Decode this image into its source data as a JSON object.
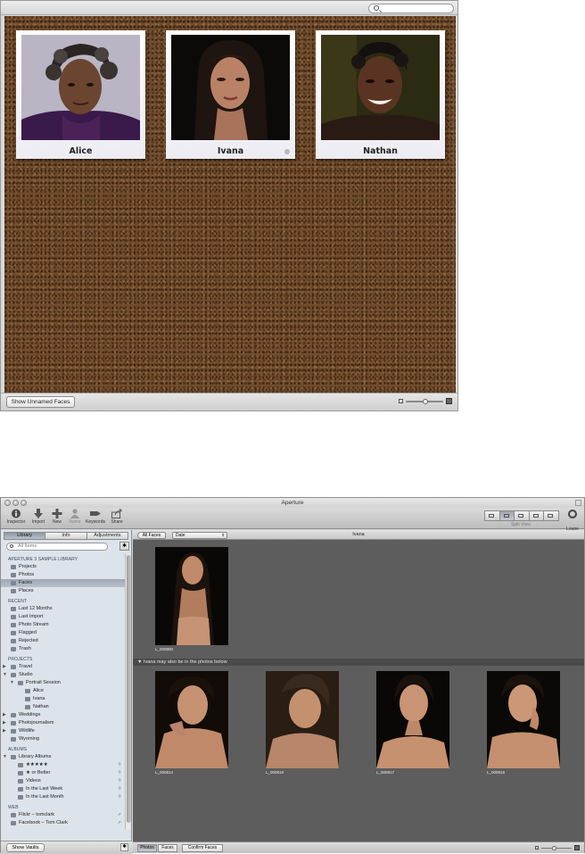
{
  "corkboard": {
    "faces": [
      {
        "name": "Alice"
      },
      {
        "name": "Ivana"
      },
      {
        "name": "Nathan"
      }
    ],
    "show_unnamed_label": "Show Unnamed Faces"
  },
  "aperture": {
    "window_title": "Aperture",
    "toolbar": {
      "left": [
        "Inspector",
        "Import",
        "New",
        "Name",
        "Keywords",
        "Share"
      ],
      "split_view_label": "Split View",
      "loupe_label": "Loupe"
    },
    "sidebar": {
      "tabs": [
        "Library",
        "Info",
        "Adjustments"
      ],
      "active_tab": "Library",
      "search_placeholder": "All Items",
      "sections": [
        {
          "title": "APERTURE 3 SAMPLE LIBRARY",
          "items": [
            {
              "label": "Projects",
              "icon": "projects-icon"
            },
            {
              "label": "Photos",
              "icon": "photos-icon"
            },
            {
              "label": "Faces",
              "icon": "faces-icon",
              "selected": true
            },
            {
              "label": "Places",
              "icon": "places-icon"
            }
          ]
        },
        {
          "title": "RECENT",
          "items": [
            {
              "label": "Last 12 Months",
              "icon": "calendar-icon"
            },
            {
              "label": "Last Import",
              "icon": "import-icon"
            },
            {
              "label": "Photo Stream",
              "icon": "photo-stream-icon"
            },
            {
              "label": "Flagged",
              "icon": "flag-icon"
            },
            {
              "label": "Rejected",
              "icon": "reject-icon"
            },
            {
              "label": "Trash",
              "icon": "trash-icon"
            }
          ]
        },
        {
          "title": "PROJECTS",
          "items": [
            {
              "label": "Travel",
              "icon": "folder-icon",
              "disclosure": "closed"
            },
            {
              "label": "Studio",
              "icon": "folder-icon",
              "disclosure": "open"
            },
            {
              "label": "Portrait Session",
              "icon": "project-icon",
              "disclosure": "open",
              "indent": 1
            },
            {
              "label": "Alice",
              "icon": "album-icon",
              "indent": 2
            },
            {
              "label": "Ivana",
              "icon": "album-icon",
              "indent": 2
            },
            {
              "label": "Nathan",
              "icon": "album-icon",
              "indent": 2
            },
            {
              "label": "Weddings",
              "icon": "folder-icon",
              "disclosure": "closed"
            },
            {
              "label": "Photojournalism",
              "icon": "folder-icon",
              "disclosure": "closed"
            },
            {
              "label": "Wildlife",
              "icon": "folder-icon",
              "disclosure": "closed"
            },
            {
              "label": "Wyoming",
              "icon": "project-icon"
            }
          ]
        },
        {
          "title": "ALBUMS",
          "items": [
            {
              "label": "Library Albums",
              "icon": "albums-icon",
              "disclosure": "open"
            },
            {
              "label": "★★★★★",
              "icon": "smart-album-icon",
              "indent": 1,
              "smart": true
            },
            {
              "label": "★ or Better",
              "icon": "smart-album-icon",
              "indent": 1,
              "smart": true
            },
            {
              "label": "Videos",
              "icon": "smart-album-icon",
              "indent": 1,
              "smart": true
            },
            {
              "label": "In the Last Week",
              "icon": "smart-album-icon",
              "indent": 1,
              "smart": true
            },
            {
              "label": "In the Last Month",
              "icon": "smart-album-icon",
              "indent": 1,
              "smart": true
            }
          ]
        },
        {
          "title": "WEB",
          "items": [
            {
              "label": "Flickr – tomclark",
              "icon": "web-icon",
              "share": true
            },
            {
              "label": "Facebook – Tom Clark",
              "icon": "web-icon",
              "share": true
            }
          ]
        }
      ],
      "show_vaults_label": "Show Vaults"
    },
    "browser": {
      "all_faces_label": "All Faces",
      "sort_label": "Date",
      "title": "Ivana",
      "confirmed": [
        {
          "label": "L_000800"
        }
      ],
      "maybe_bar_text": "Ivana may also be in the photos below",
      "suggested": [
        {
          "label": "L_000814"
        },
        {
          "label": "L_000819"
        },
        {
          "label": "L_000817"
        },
        {
          "label": "L_000818"
        }
      ],
      "bottom_buttons": [
        "Photos",
        "Faces",
        "Confirm Faces"
      ],
      "active_bottom": "Photos"
    }
  }
}
